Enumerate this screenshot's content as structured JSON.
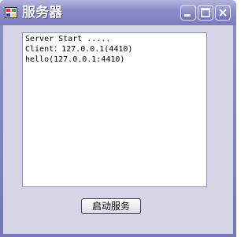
{
  "window": {
    "title": "服务器"
  },
  "log": {
    "lines": [
      "Server Start .....",
      "Client：127.0.0.1(4410)",
      "hello(127.0.0.1:4410)"
    ]
  },
  "buttons": {
    "start_label": "启动服务"
  },
  "icons": {
    "app": "app-window-icon",
    "minimize": "minimize-icon",
    "maximize": "maximize-icon",
    "close": "close-icon"
  },
  "colors": {
    "titlebar": "#8d8dcc",
    "client_background": "#d6d5e8"
  }
}
